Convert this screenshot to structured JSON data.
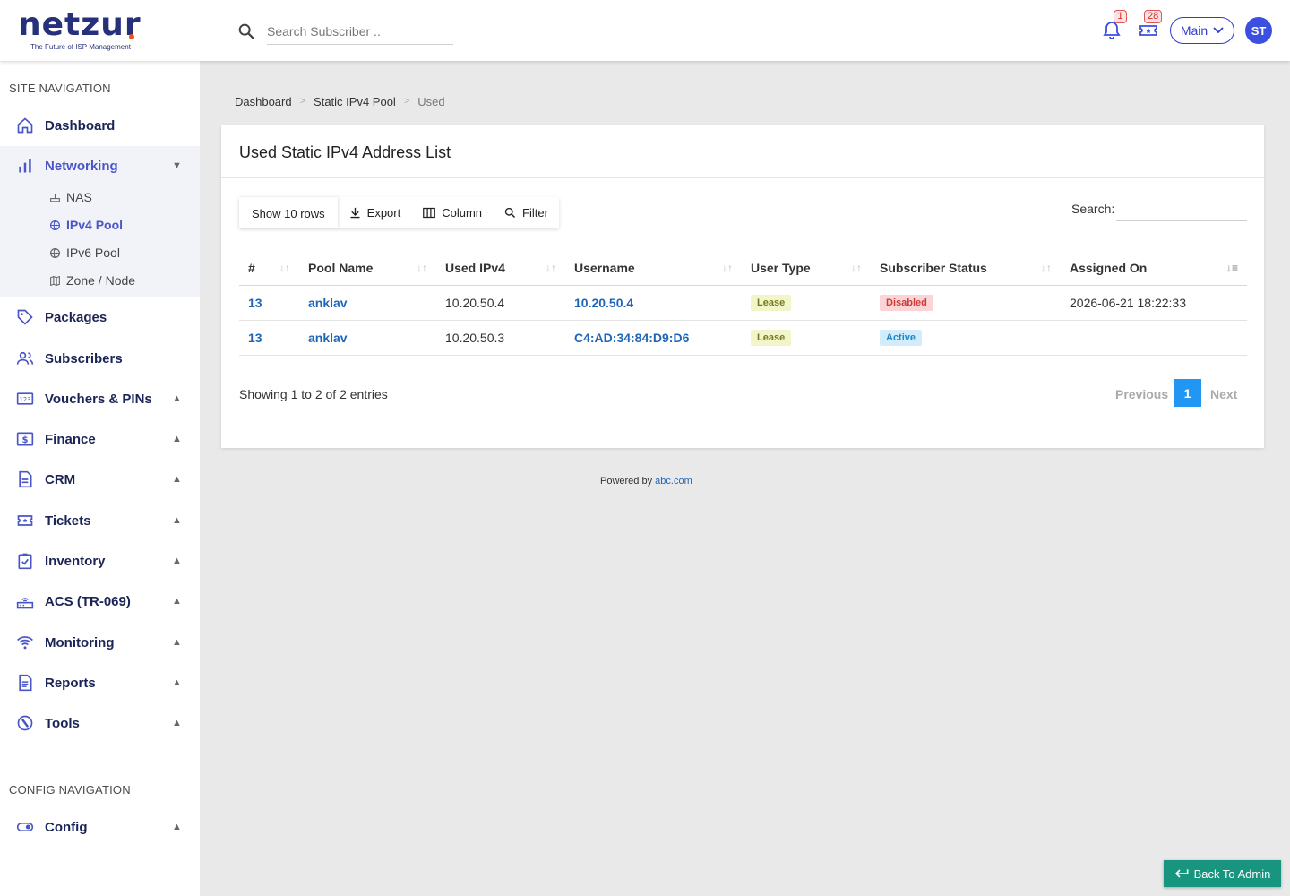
{
  "brand": {
    "name": "netzur",
    "tagline": "The Future of ISP Management"
  },
  "header": {
    "search_placeholder": "Search Subscriber ..",
    "notifications_count": "1",
    "tickets_count": "28",
    "context_label": "Main",
    "avatar_initials": "ST"
  },
  "sidebar": {
    "site_heading": "SITE NAVIGATION",
    "items": [
      {
        "label": "Dashboard",
        "icon": "home-icon"
      },
      {
        "label": "Networking",
        "icon": "bar-chart-icon"
      },
      {
        "label": "Packages",
        "icon": "tag-icon"
      },
      {
        "label": "Subscribers",
        "icon": "users-icon"
      },
      {
        "label": "Vouchers & PINs",
        "icon": "pin-123-icon"
      },
      {
        "label": "Finance",
        "icon": "dollar-box-icon"
      },
      {
        "label": "CRM",
        "icon": "document-icon"
      },
      {
        "label": "Tickets",
        "icon": "ticket-icon"
      },
      {
        "label": "Inventory",
        "icon": "clipboard-check-icon"
      },
      {
        "label": "ACS (TR-069)",
        "icon": "router-icon"
      },
      {
        "label": "Monitoring",
        "icon": "signal-icon"
      },
      {
        "label": "Reports",
        "icon": "report-icon"
      },
      {
        "label": "Tools",
        "icon": "wrench-icon"
      }
    ],
    "networking_sub": [
      {
        "label": "NAS",
        "icon": "nas-icon"
      },
      {
        "label": "IPv4 Pool",
        "icon": "globe-icon"
      },
      {
        "label": "IPv6 Pool",
        "icon": "globe-icon"
      },
      {
        "label": "Zone / Node",
        "icon": "map-icon"
      }
    ],
    "config_heading": "CONFIG NAVIGATION",
    "config_items": [
      {
        "label": "Config",
        "icon": "toggle-icon"
      }
    ]
  },
  "breadcrumb": {
    "items": [
      "Dashboard",
      "Static IPv4 Pool",
      "Used"
    ],
    "separator": ">"
  },
  "card": {
    "title": "Used Static IPv4 Address List",
    "toolbar": {
      "rows_label": "Show 10 rows",
      "export_label": "Export",
      "column_label": "Column",
      "filter_label": "Filter"
    },
    "search_label": "Search:",
    "columns": [
      "#",
      "Pool Name",
      "Used IPv4",
      "Username",
      "User Type",
      "Subscriber Status",
      "Assigned On"
    ],
    "rows": [
      {
        "id": "13",
        "pool": "anklav",
        "ipv4": "10.20.50.4",
        "username": "10.20.50.4",
        "user_type": "Lease",
        "status": "Disabled",
        "assigned_on": "2026-06-21 18:22:33"
      },
      {
        "id": "13",
        "pool": "anklav",
        "ipv4": "10.20.50.3",
        "username": "C4:AD:34:84:D9:D6",
        "user_type": "Lease",
        "status": "Active",
        "assigned_on": ""
      }
    ],
    "info": "Showing 1 to 2 of 2 entries",
    "pagination": {
      "previous": "Previous",
      "page": "1",
      "next": "Next"
    }
  },
  "footer": {
    "prefix": "Powered by",
    "link": "abc.com"
  },
  "back_button": "Back To Admin",
  "colors": {
    "brand": "#27307a",
    "accent": "#4a56c8",
    "link": "#1f66b8",
    "primary": "#2196f3",
    "success": "#17957f",
    "danger": "#d03a3a"
  }
}
